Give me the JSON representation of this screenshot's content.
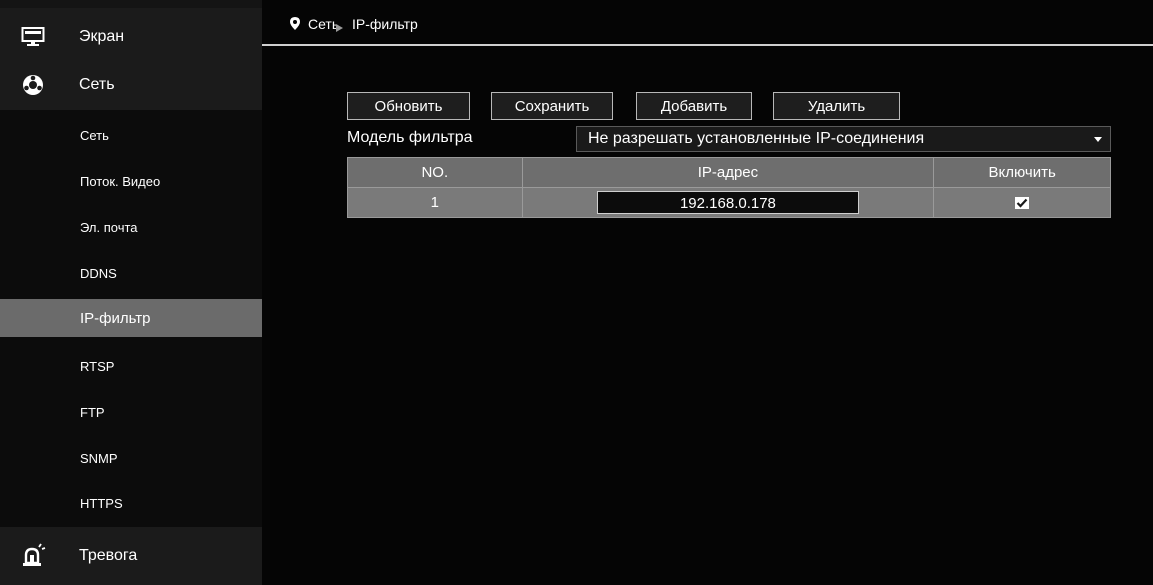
{
  "sidebar": {
    "top_items": [
      {
        "label": "Экран",
        "icon": "monitor-icon"
      },
      {
        "label": "Сеть",
        "icon": "network-icon"
      },
      {
        "label": "Тревога",
        "icon": "alarm-bell-icon"
      }
    ],
    "sub_items": [
      {
        "label": "Сеть"
      },
      {
        "label": "Поток. Видео"
      },
      {
        "label": "Эл. почта"
      },
      {
        "label": "DDNS"
      },
      {
        "label": "IP-фильтр",
        "active": true
      },
      {
        "label": "RTSP"
      },
      {
        "label": "FTP"
      },
      {
        "label": "SNMP"
      },
      {
        "label": "HTTPS"
      }
    ]
  },
  "breadcrumb": {
    "section": "Сеть",
    "page": "IP-фильтр",
    "icon": "location-pin-icon"
  },
  "toolbar": {
    "refresh": "Обновить",
    "save": "Сохранить",
    "add": "Добавить",
    "delete": "Удалить"
  },
  "filter": {
    "label": "Модель фильтра",
    "value": "Не разрешать установленные IP-соединения"
  },
  "table": {
    "headers": [
      "NO.",
      "IP-адрес",
      "Включить"
    ],
    "rows": [
      {
        "no": "1",
        "ip": "192.168.0.178",
        "enabled": true
      }
    ]
  },
  "colors": {
    "sidebar_bg": "#141414",
    "active_item_bg": "#6b6b6b",
    "main_bg": "#050505",
    "table_bg": "#7a7a7a"
  }
}
